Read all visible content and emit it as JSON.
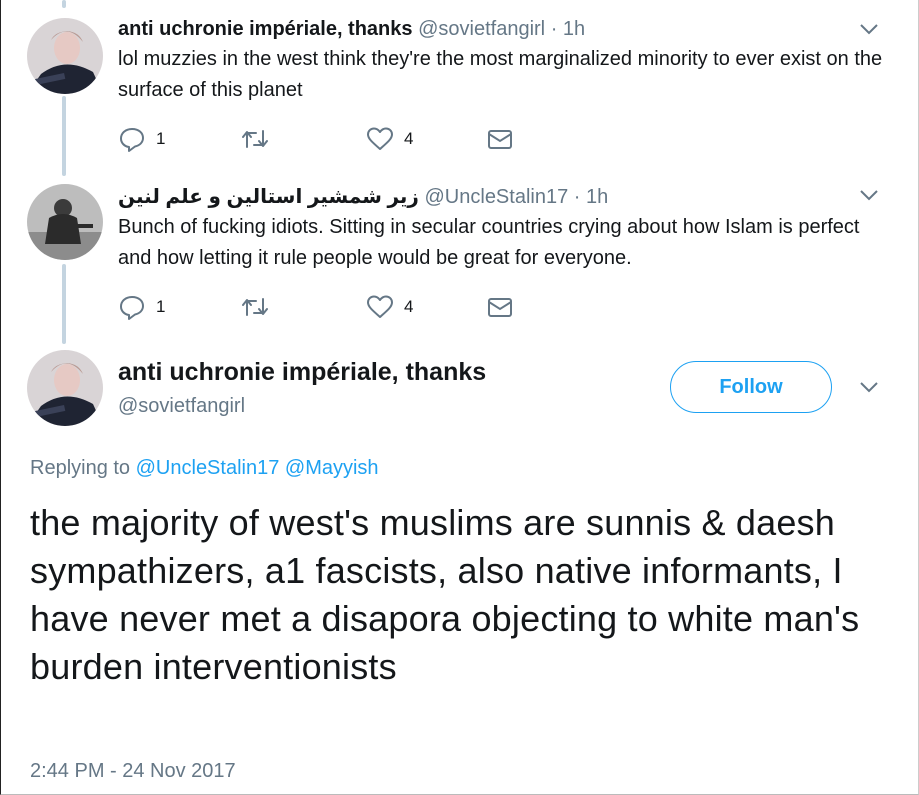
{
  "thread": [
    {
      "name": "anti uchronie impériale, thanks",
      "handle": "@sovietfangirl",
      "time": "1h",
      "text": "lol muzzies in the west think they're the most marginalized minority to ever exist on the surface of this planet",
      "replies": "1",
      "retweets": "",
      "likes": "4"
    },
    {
      "name": "زیر شمشیر استالین و علم لنین",
      "handle": "@UncleStalin17",
      "time": "1h",
      "text": "Bunch of fucking idiots. Sitting in secular countries crying about how Islam is perfect and how letting it rule people would be great for everyone.",
      "replies": "1",
      "retweets": "",
      "likes": "4"
    }
  ],
  "separator": "·",
  "main": {
    "name": "anti uchronie impériale, thanks",
    "handle": "@sovietfangirl",
    "follow_label": "Follow",
    "replying_label": "Replying to",
    "replying_to": [
      "@UncleStalin17",
      "@Mayyish"
    ],
    "text": "the majority of west's muslims are sunnis & daesh sympathizers, a1 fascists, also native informants, I have never met a disapora objecting to white man's burden interventionists",
    "timestamp": "2:44 PM - 24 Nov 2017"
  },
  "icons": {
    "reply": "reply-icon",
    "retweet": "retweet-icon",
    "like": "heart-icon",
    "dm": "envelope-icon",
    "more": "chevron-down-icon"
  },
  "colors": {
    "accent": "#1da1f2",
    "muted": "#657786",
    "thread_line": "#c4d4e0"
  }
}
